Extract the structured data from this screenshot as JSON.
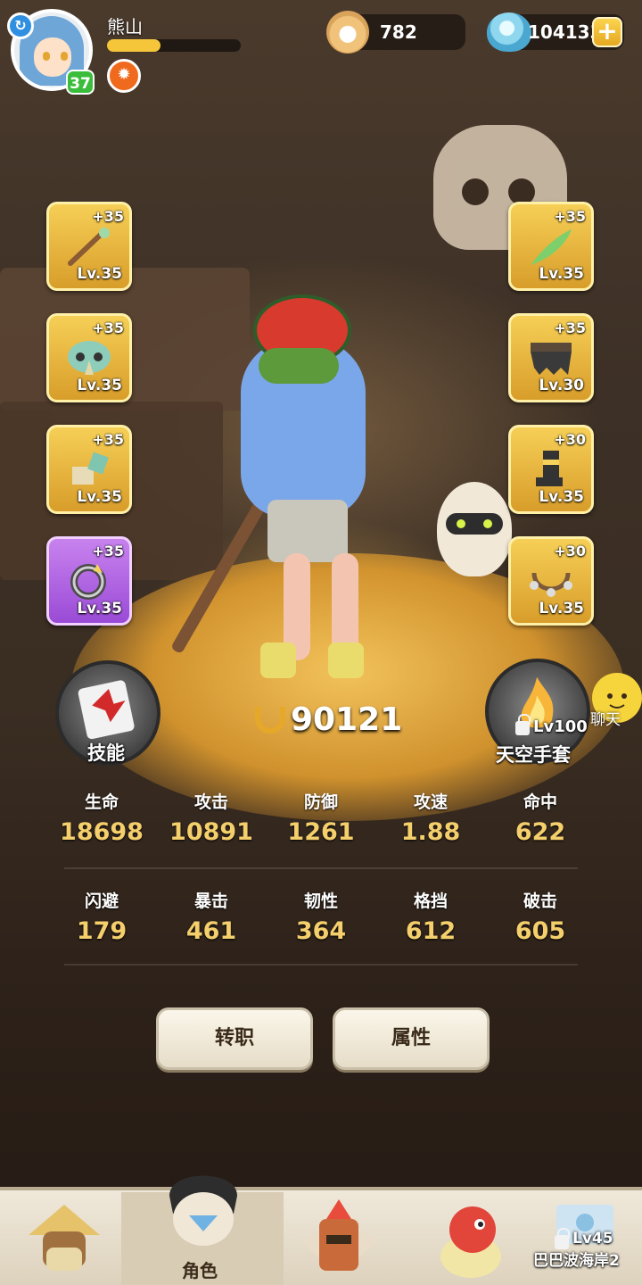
{
  "player": {
    "name": "熊山",
    "level": "37",
    "exp_fraction": 0.4
  },
  "currencies": {
    "pearls": "782",
    "crystals": "104133"
  },
  "equipment": {
    "left": [
      {
        "plus": "+35",
        "level": "Lv.35",
        "icon": "staff-icon",
        "rarity": "gold"
      },
      {
        "plus": "+35",
        "level": "Lv.35",
        "icon": "mask-icon",
        "rarity": "gold"
      },
      {
        "plus": "+35",
        "level": "Lv.35",
        "icon": "bracer-icon",
        "rarity": "gold"
      },
      {
        "plus": "+35",
        "level": "Lv.35",
        "icon": "ring-icon",
        "rarity": "purple"
      }
    ],
    "right": [
      {
        "plus": "+35",
        "level": "Lv.35",
        "icon": "feather-icon",
        "rarity": "gold"
      },
      {
        "plus": "+35",
        "level": "Lv.30",
        "icon": "skirt-icon",
        "rarity": "gold"
      },
      {
        "plus": "+30",
        "level": "Lv.35",
        "icon": "boots-icon",
        "rarity": "gold"
      },
      {
        "plus": "+30",
        "level": "Lv.35",
        "icon": "necklace-icon",
        "rarity": "gold"
      }
    ]
  },
  "skill": {
    "label": "技能"
  },
  "special": {
    "lock_level": "Lv100",
    "label": "天空手套"
  },
  "chat": {
    "label": "聊天"
  },
  "power": "90121",
  "stats_row1": [
    {
      "name": "生命",
      "value": "18698"
    },
    {
      "name": "攻击",
      "value": "10891"
    },
    {
      "name": "防御",
      "value": "1261"
    },
    {
      "name": "攻速",
      "value": "1.88"
    },
    {
      "name": "命中",
      "value": "622"
    }
  ],
  "stats_row2": [
    {
      "name": "闪避",
      "value": "179"
    },
    {
      "name": "暴击",
      "value": "461"
    },
    {
      "name": "韧性",
      "value": "364"
    },
    {
      "name": "格挡",
      "value": "612"
    },
    {
      "name": "破击",
      "value": "605"
    }
  ],
  "actions": {
    "job_change": "转职",
    "attributes": "属性"
  },
  "nav": {
    "character": "角色",
    "locked_level": "Lv45",
    "locked_area": "巴巴波海岸2"
  },
  "colors": {
    "gold_slot": "#f6cf56",
    "purple_slot": "#c882ee",
    "stat_value": "#f4cf6c",
    "level_badge": "#3bbd3b"
  }
}
